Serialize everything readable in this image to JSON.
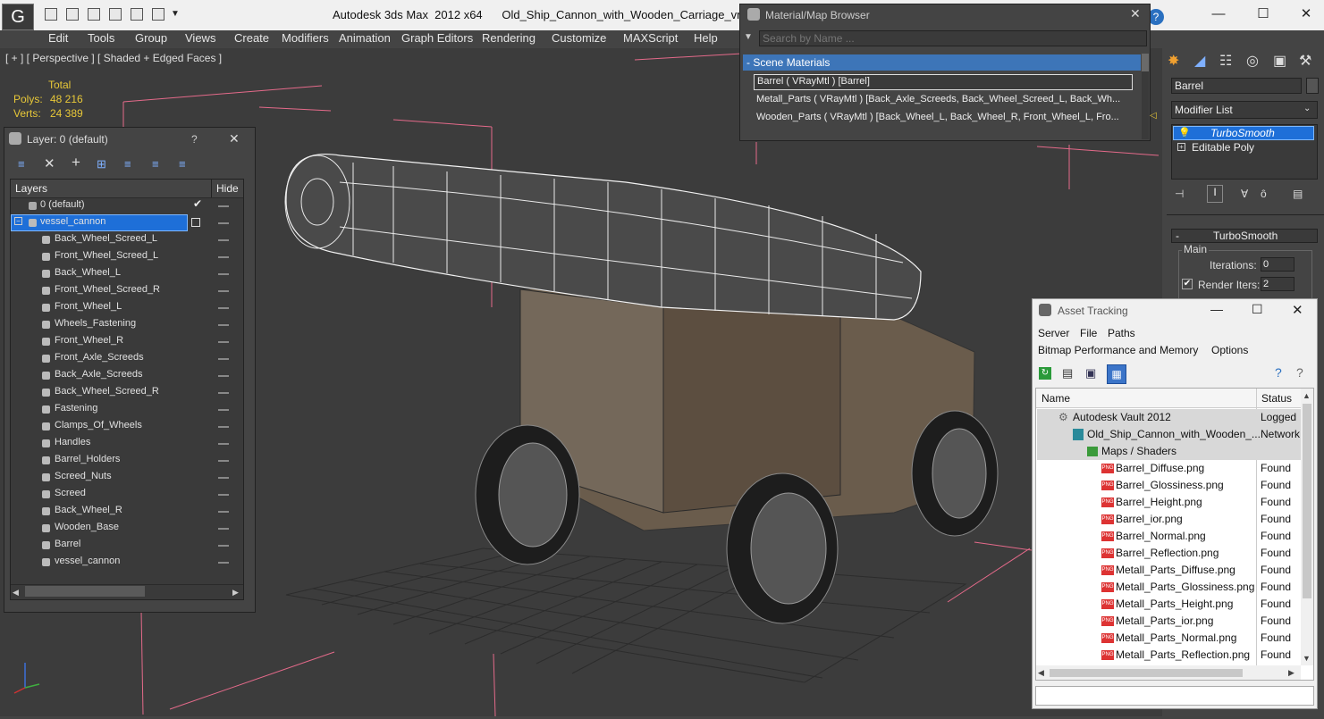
{
  "titlebar": {
    "app_title": "Autodesk 3ds Max  2012 x64",
    "file_name": "Old_Ship_Cannon_with_Wooden_Carriage_vray.max",
    "minimize": "—",
    "maximize": "☐",
    "close": "✕"
  },
  "menubar": [
    "Edit",
    "Tools",
    "Group",
    "Views",
    "Create",
    "Modifiers",
    "Animation",
    "Graph Editors",
    "Rendering",
    "Customize",
    "MAXScript",
    "Help"
  ],
  "viewport": {
    "label": "[ + ] [ Perspective ] [ Shaded + Edged Faces ]",
    "stats_header": "Total",
    "polys_label": "Polys:",
    "polys_value": "48 216",
    "verts_label": "Verts:",
    "verts_value": "24 389"
  },
  "layer_panel": {
    "title": "Layer: 0 (default)",
    "help": "?",
    "close": "✕",
    "col_layers": "Layers",
    "col_hide": "Hide",
    "layers": [
      {
        "name": "0 (default)"
      },
      {
        "name": "vessel_cannon"
      }
    ],
    "objects": [
      "Back_Wheel_Screed_L",
      "Front_Wheel_Screed_L",
      "Back_Wheel_L",
      "Front_Wheel_Screed_R",
      "Front_Wheel_L",
      "Wheels_Fastening",
      "Front_Wheel_R",
      "Front_Axle_Screeds",
      "Back_Axle_Screeds",
      "Back_Wheel_Screed_R",
      "Fastening",
      "Clamps_Of_Wheels",
      "Handles",
      "Barrel_Holders",
      "Screed_Nuts",
      "Screed",
      "Back_Wheel_R",
      "Wooden_Base",
      "Barrel",
      "vessel_cannon"
    ]
  },
  "material_browser": {
    "title": "Material/Map Browser",
    "search_placeholder": "Search by Name ...",
    "section": "- Scene Materials",
    "materials": [
      "Barrel  ( VRayMtl )  [Barrel]",
      "Metall_Parts  ( VRayMtl )  [Back_Axle_Screeds, Back_Wheel_Screed_L, Back_Wh...",
      "Wooden_Parts  ( VRayMtl )  [Back_Wheel_L, Back_Wheel_R, Front_Wheel_L, Fro..."
    ]
  },
  "command_panel": {
    "object_name": "Barrel",
    "modifier_list": "Modifier List",
    "stack": [
      "TurboSmooth",
      "Editable Poly"
    ],
    "rollout_title": "TurboSmooth",
    "group_main": "Main",
    "iterations_label": "Iterations:",
    "iterations_value": "0",
    "render_iters_label": "Render Iters:",
    "render_iters_value": "2"
  },
  "asset_tracking": {
    "title": "Asset Tracking",
    "menu": [
      "Server",
      "File",
      "Paths"
    ],
    "menu2": [
      "Bitmap Performance and Memory",
      "Options"
    ],
    "col_name": "Name",
    "col_status": "Status",
    "rows": [
      {
        "name": "Autodesk Vault 2012",
        "status": "Logged",
        "type": "vault"
      },
      {
        "name": "Old_Ship_Cannon_with_Wooden_...",
        "status": "Network",
        "type": "max"
      },
      {
        "name": "Maps / Shaders",
        "status": "",
        "type": "folder"
      },
      {
        "name": "Barrel_Diffuse.png",
        "status": "Found",
        "type": "png"
      },
      {
        "name": "Barrel_Glossiness.png",
        "status": "Found",
        "type": "png"
      },
      {
        "name": "Barrel_Height.png",
        "status": "Found",
        "type": "png"
      },
      {
        "name": "Barrel_ior.png",
        "status": "Found",
        "type": "png"
      },
      {
        "name": "Barrel_Normal.png",
        "status": "Found",
        "type": "png"
      },
      {
        "name": "Barrel_Reflection.png",
        "status": "Found",
        "type": "png"
      },
      {
        "name": "Metall_Parts_Diffuse.png",
        "status": "Found",
        "type": "png"
      },
      {
        "name": "Metall_Parts_Glossiness.png",
        "status": "Found",
        "type": "png"
      },
      {
        "name": "Metall_Parts_Height.png",
        "status": "Found",
        "type": "png"
      },
      {
        "name": "Metall_Parts_ior.png",
        "status": "Found",
        "type": "png"
      },
      {
        "name": "Metall_Parts_Normal.png",
        "status": "Found",
        "type": "png"
      },
      {
        "name": "Metall_Parts_Reflection.png",
        "status": "Found",
        "type": "png"
      }
    ]
  },
  "colors": {
    "accent": "#3399ff",
    "stats": "#e8c838",
    "selection": "#1e90ff"
  }
}
